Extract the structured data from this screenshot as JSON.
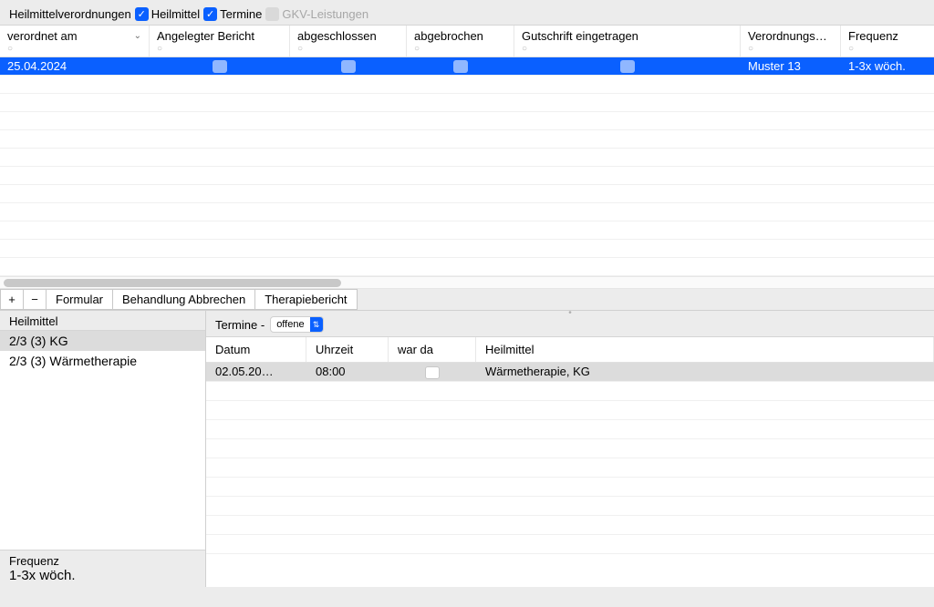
{
  "filters": {
    "title": "Heilmittelverordnungen",
    "heilmittel_label": "Heilmittel",
    "heilmittel_checked": true,
    "termine_label": "Termine",
    "termine_checked": true,
    "gkv_label": "GKV-Leistungen",
    "gkv_checked": false
  },
  "columns": {
    "c0": "verordnet am",
    "c1": "Angelegter Bericht",
    "c2": "abgeschlossen",
    "c3": "abgebrochen",
    "c4": "Gutschrift eingetragen",
    "c5": "Verordnungs…",
    "c6": "Frequenz"
  },
  "row": {
    "date": "25.04.2024",
    "verordnung": "Muster 13",
    "frequenz": "1-3x wöch."
  },
  "actions": {
    "plus": "+",
    "minus": "−",
    "formular": "Formular",
    "abbrechen": "Behandlung Abbrechen",
    "bericht": "Therapiebericht"
  },
  "heilmittel": {
    "title": "Heilmittel",
    "item1": "2/3 (3) KG",
    "item2": "2/3 (3) Wärmetherapie",
    "freq_label": "Frequenz",
    "freq_value": "1-3x wöch."
  },
  "termine": {
    "label": "Termine -",
    "filter": "offene",
    "cols": {
      "c0": "Datum",
      "c1": "Uhrzeit",
      "c2": "war da",
      "c3": "Heilmittel"
    },
    "row": {
      "datum": "02.05.20…",
      "uhrzeit": "08:00",
      "heilmittel": "Wärmetherapie, KG"
    }
  }
}
